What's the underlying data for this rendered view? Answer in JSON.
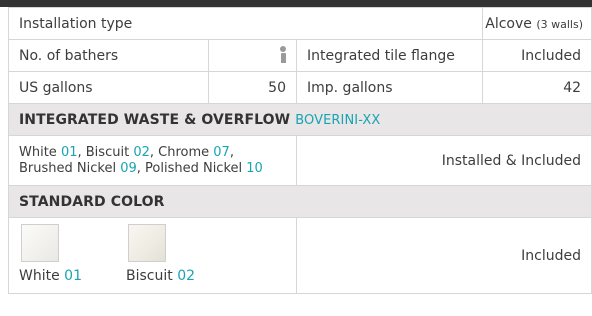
{
  "installation": {
    "label": "Installation type",
    "value_main": "Alcove",
    "value_note": "(3 walls)"
  },
  "bathers": {
    "label": "No. of bathers",
    "icon": "person-icon"
  },
  "flange": {
    "label": "Integrated tile flange",
    "value": "Included"
  },
  "us_gallons": {
    "label": "US gallons",
    "value": "50"
  },
  "imp_gallons": {
    "label": "Imp. gallons",
    "value": "42"
  },
  "waste": {
    "heading": "INTEGRATED WASTE & OVERFLOW",
    "code": "BOVERINI-XX",
    "finishes": [
      {
        "name": "White",
        "code": "01"
      },
      {
        "name": "Biscuit",
        "code": "02"
      },
      {
        "name": "Chrome",
        "code": "07"
      },
      {
        "name": "Brushed Nickel",
        "code": "09"
      },
      {
        "name": "Polished Nickel",
        "code": "10"
      }
    ],
    "status": "Installed & Included"
  },
  "standard_color": {
    "heading": "STANDARD COLOR",
    "colors": [
      {
        "name": "White",
        "code": "01",
        "swatch": "#f4f3ef"
      },
      {
        "name": "Biscuit",
        "code": "02",
        "swatch": "#ece9df"
      }
    ],
    "status": "Included"
  }
}
